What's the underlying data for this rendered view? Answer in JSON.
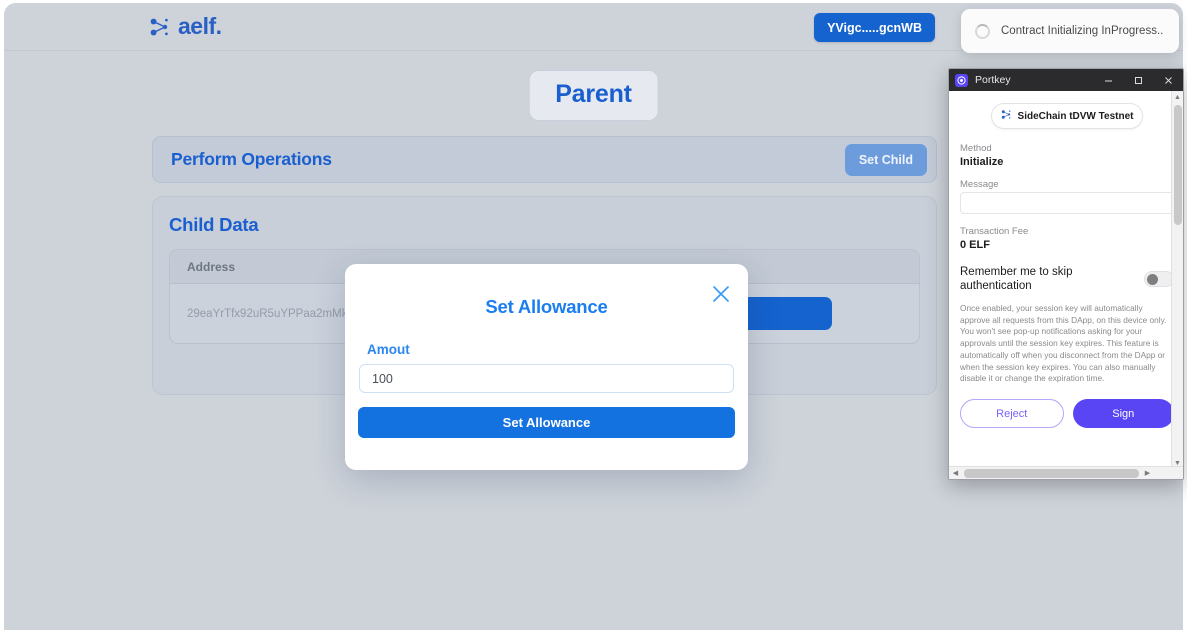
{
  "appbar": {
    "brand_text": "aelf.",
    "brand_icon": "aelf-dots-icon",
    "wallet_button_label": "YVigc.....gcnWB"
  },
  "toast": {
    "icon": "spinner-icon",
    "text": "Contract Initializing InProgress.."
  },
  "main": {
    "page_title": "Parent",
    "operations": {
      "heading": "Perform Operations",
      "set_child_label": "Set Child"
    },
    "child_data": {
      "heading": "Child Data",
      "columns": [
        "Address"
      ],
      "rows": [
        {
          "address": "29eaYrTfx92uR5uYPPaa2mMkBHnS"
        }
      ]
    }
  },
  "modal": {
    "title": "Set Allowance",
    "close_icon": "close-icon",
    "amount_label": "Amout",
    "amount_value": "100",
    "submit_label": "Set Allowance"
  },
  "portkey": {
    "window_title": "Portkey",
    "logo_icon": "portkey-logo-icon",
    "minimize_icon": "minimize-icon",
    "maximize_icon": "maximize-icon",
    "close_icon": "close-icon",
    "chain": {
      "icon": "aelf-dots-icon",
      "label": "SideChain tDVW Testnet"
    },
    "method_label": "Method",
    "method_value": "Initialize",
    "message_label": "Message",
    "message_value": "",
    "fee_label": "Transaction Fee",
    "fee_value": "0 ELF",
    "remember_label": "Remember me to skip authentication",
    "remember_enabled": false,
    "fineprint": "Once enabled, your session key will automatically approve all requests from this DApp, on this device only. You won't see pop-up notifications asking for your approvals until the session key expires. This feature is automatically off when you disconnect from the DApp or when the session key expires. You can also manually disable it or change the expiration time.",
    "reject_label": "Reject",
    "sign_label": "Sign"
  },
  "colors": {
    "page_background": "#ced3da",
    "brand_blue": "#2a5fc4",
    "accent_blue": "#1563cf",
    "modal_title_blue": "#1a7df0",
    "portkey_purple": "#5a45f5"
  }
}
